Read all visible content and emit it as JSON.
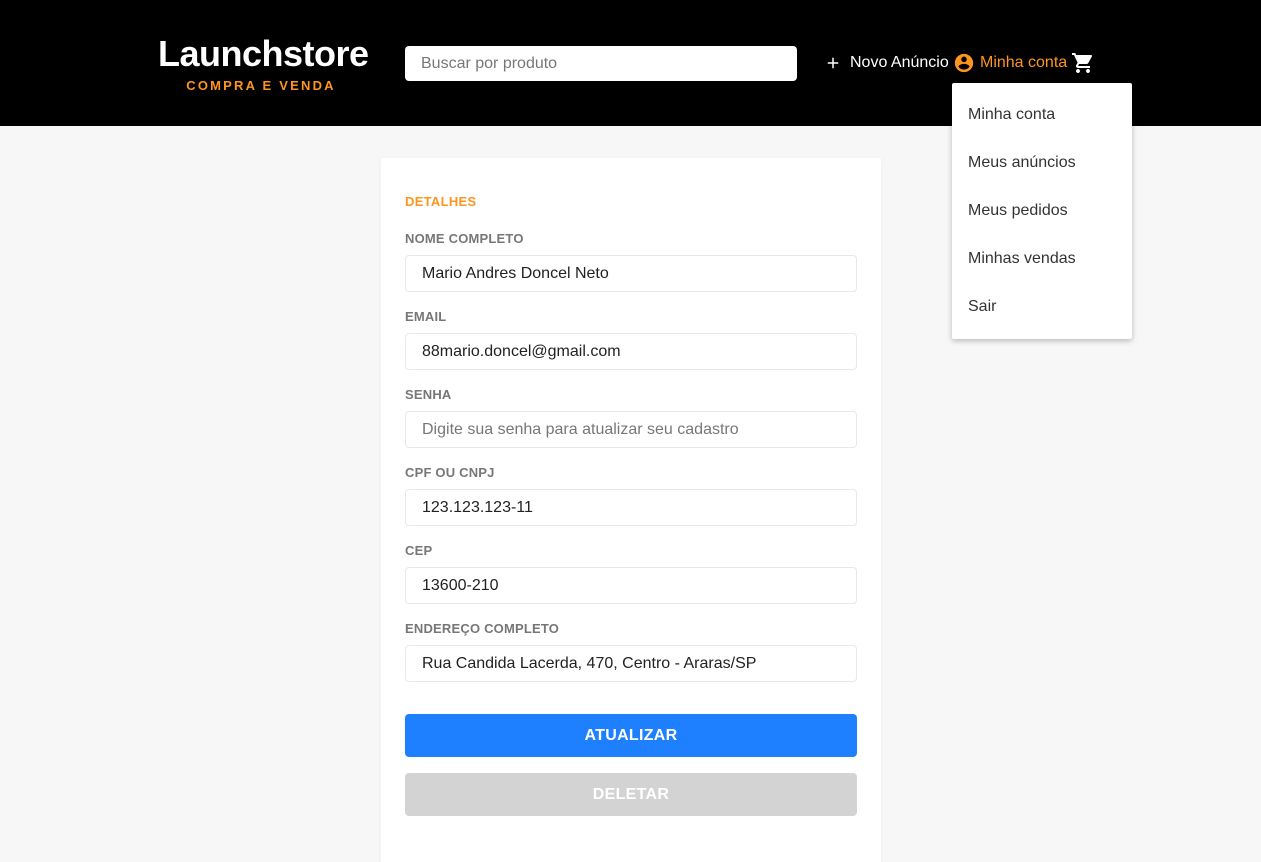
{
  "header": {
    "logo_title": "Launchstore",
    "logo_subtitle": "COMPRA E VENDA",
    "search_placeholder": "Buscar por produto",
    "new_ad_label": "Novo Anúncio",
    "account_label": "Minha conta",
    "icons": {
      "new_ad": "plus-icon",
      "account": "account-circle-icon",
      "cart": "shopping-cart-icon"
    }
  },
  "account_menu": {
    "items": [
      {
        "label": "Minha conta"
      },
      {
        "label": "Meus anúncios"
      },
      {
        "label": "Meus pedidos"
      },
      {
        "label": "Minhas vendas"
      },
      {
        "label": "Sair"
      }
    ]
  },
  "form": {
    "section_title": "DETALHES",
    "fields": {
      "name": {
        "label": "NOME COMPLETO",
        "value": "Mario Andres Doncel Neto"
      },
      "email": {
        "label": "EMAIL",
        "value": "88mario.doncel@gmail.com"
      },
      "password": {
        "label": "SENHA",
        "value": "",
        "placeholder": "Digite sua senha para atualizar seu cadastro"
      },
      "cpf_cnpj": {
        "label": "CPF OU CNPJ",
        "value": "123.123.123-11"
      },
      "cep": {
        "label": "CEP",
        "value": "13600-210"
      },
      "address": {
        "label": "ENDEREÇO COMPLETO",
        "value": "Rua Candida Lacerda, 470, Centro - Araras/SP"
      }
    },
    "update_button": "ATUALIZAR",
    "delete_button": "DELETAR"
  },
  "colors": {
    "header_bg": "#000000",
    "accent": "#fd951f",
    "primary_button": "#1f80ff",
    "delete_button": "#d3d3d3",
    "page_bg": "#f7f7f7"
  }
}
